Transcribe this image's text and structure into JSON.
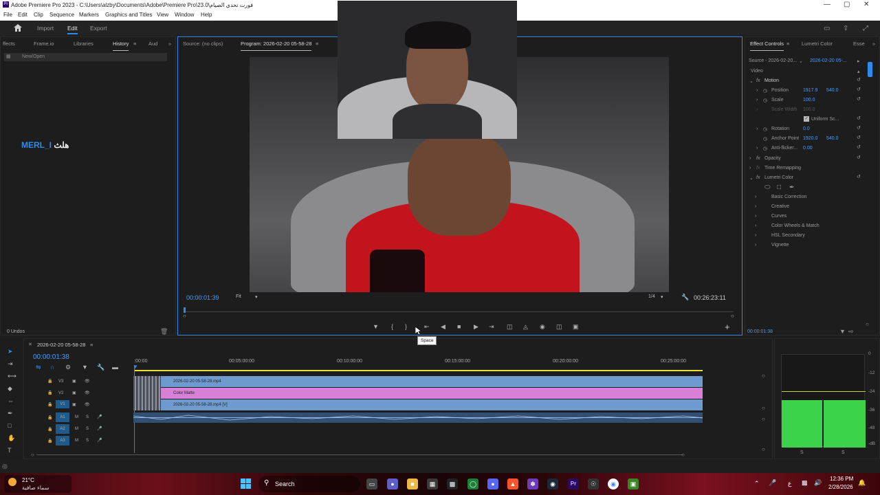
{
  "window": {
    "title": "Adobe Premiere Pro 2023 - C:\\Users\\alzby\\Documents\\Adobe\\Premiere Pro\\23.0\\فورت تحدي الصيام",
    "logo": "Pr"
  },
  "menu": [
    "File",
    "Edit",
    "Clip",
    "Sequence",
    "Markers",
    "Graphics and Titles",
    "View",
    "Window",
    "Help"
  ],
  "workspace": {
    "home_icon": "home-icon",
    "tabs": [
      "Import",
      "Edit",
      "Export"
    ],
    "active": "Edit"
  },
  "left_panel": {
    "tabs": [
      "ffects",
      "Frame.io",
      "Libraries",
      "History",
      "Aud"
    ],
    "active_tab": "History",
    "history_items": [
      "New/Open"
    ],
    "undo_count": "0 Undos"
  },
  "overlay_text": {
    "prefix": "MERL_I",
    "arabic": "هلث"
  },
  "monitor": {
    "source_tab": "Source: (no clips)",
    "program_tab": "Program: 2026-02-20 05-58-28",
    "current_time": "00:00:01:39",
    "zoom": "Fit",
    "resolution": "1/4",
    "duration": "00:26:23:11",
    "tooltip": "Space"
  },
  "effect_controls": {
    "tabs": [
      "Effect Controls",
      "Lumetri Color",
      "Esse"
    ],
    "source": "Source - 2026-02-20...",
    "clip": "2026-02-20 05-...",
    "section": "Video",
    "motion": {
      "label": "Motion",
      "position_label": "Position",
      "position_x": "1917.9",
      "position_y": "540.0",
      "scale_label": "Scale",
      "scale": "100.0",
      "scale_width_label": "Scale Width",
      "scale_width": "100.0",
      "uniform_label": "Uniform Sc...",
      "rotation_label": "Rotation",
      "rotation": "0.0",
      "anchor_label": "Anchor Point",
      "anchor_x": "1920.0",
      "anchor_y": "540.0",
      "antiflicker_label": "Anti-flicker...",
      "antiflicker": "0.00"
    },
    "opacity": "Opacity",
    "time_remap": "Time Remapping",
    "lumetri": "Lumetri Color",
    "lumetri_items": [
      "Basic Correction",
      "Creative",
      "Curves",
      "Color Wheels & Match",
      "HSL Secondary",
      "Vignette"
    ],
    "timecode": "00:00:01:38"
  },
  "timeline": {
    "sequence_name": "2026-02-20 05-58-28",
    "timecode": "00:00:01:38",
    "ruler": [
      ":00:00",
      "00:05:00:00",
      "00:10:00:00",
      "00:15:00:00",
      "00:20:00:00",
      "00:25:00:00"
    ],
    "tracks": [
      "V3",
      "V2",
      "V1",
      "A1",
      "A2",
      "A3"
    ],
    "clips": {
      "v3": "2026-02-20 05-58-28.mp4",
      "v2": "Color Matte",
      "v1": "2026-02-20 05-58-28.mp4 [V]"
    }
  },
  "meter": {
    "scale": [
      "0",
      "-12",
      "-24",
      "-36",
      "-48",
      "-dB"
    ],
    "solo": [
      "S",
      "S"
    ]
  },
  "taskbar": {
    "weather_temp": "21°C",
    "weather_desc": "سماء صافية",
    "search": "Search",
    "time": "12:36 PM",
    "date": "2/28/2026",
    "lang": "ع"
  },
  "colors": {
    "accent": "#2d8ceb",
    "clip_video": "#6d9bd0",
    "clip_matte": "#d87fd6",
    "meter_green": "#3cd34a"
  }
}
